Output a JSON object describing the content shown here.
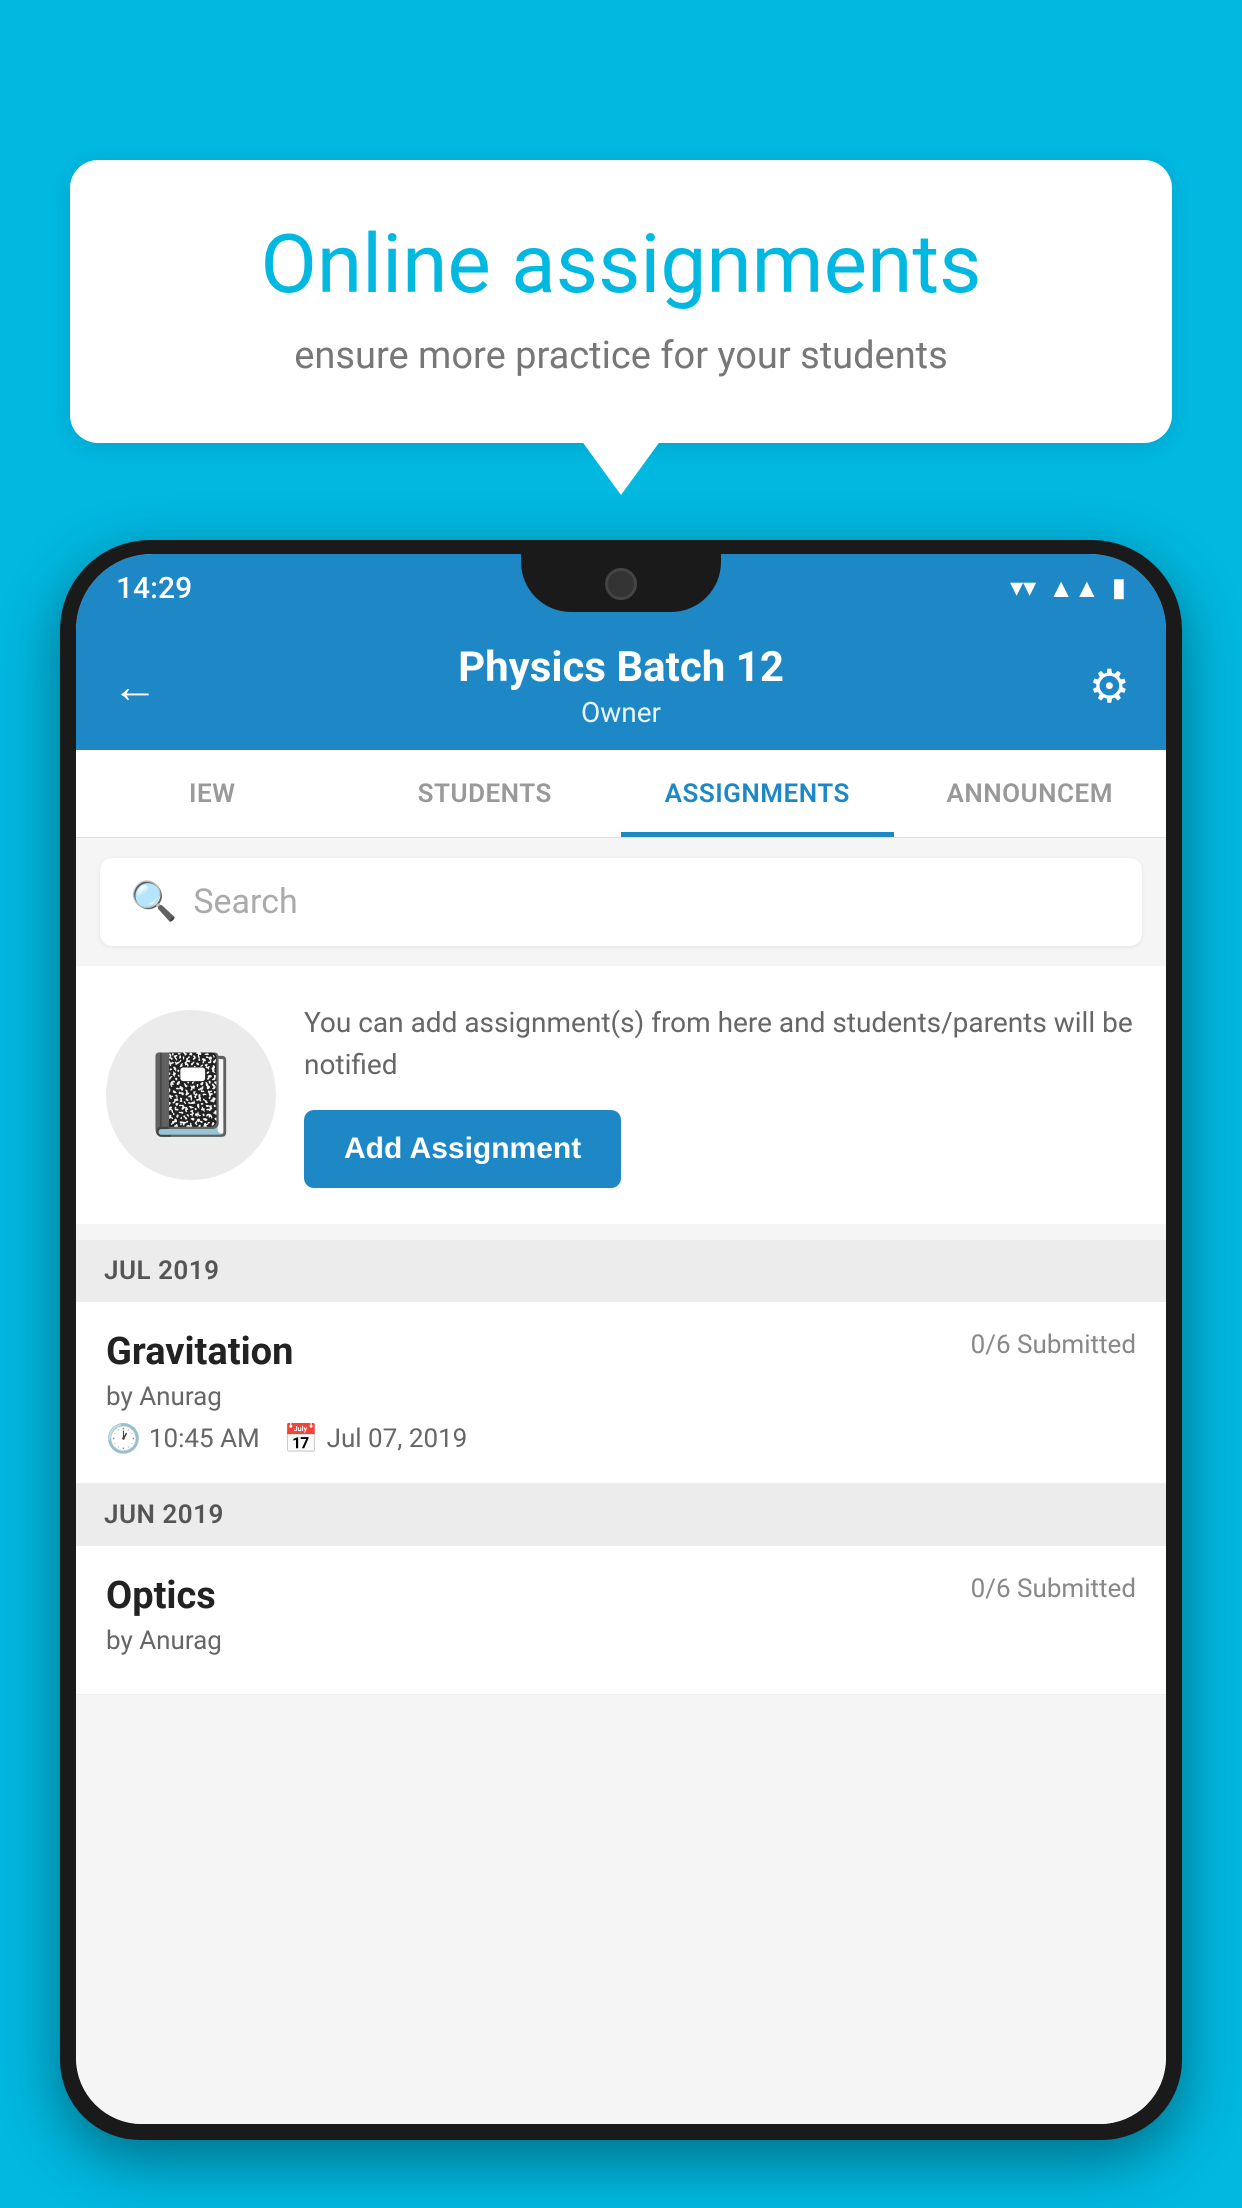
{
  "background_color": "#00b8e0",
  "bubble": {
    "title": "Online assignments",
    "subtitle": "ensure more practice for your students"
  },
  "status_bar": {
    "time": "14:29",
    "icons": [
      "wifi",
      "signal",
      "battery"
    ]
  },
  "header": {
    "title": "Physics Batch 12",
    "subtitle": "Owner",
    "back_label": "←",
    "settings_label": "⚙"
  },
  "tabs": [
    {
      "label": "IEW",
      "active": false
    },
    {
      "label": "STUDENTS",
      "active": false
    },
    {
      "label": "ASSIGNMENTS",
      "active": true
    },
    {
      "label": "ANNOUNCEM",
      "active": false
    }
  ],
  "search": {
    "placeholder": "Search"
  },
  "promo": {
    "description": "You can add assignment(s) from here and students/parents will be notified",
    "button_label": "Add Assignment"
  },
  "sections": [
    {
      "month": "JUL 2019",
      "assignments": [
        {
          "name": "Gravitation",
          "submitted": "0/6 Submitted",
          "by": "by Anurag",
          "time": "10:45 AM",
          "date": "Jul 07, 2019"
        }
      ]
    },
    {
      "month": "JUN 2019",
      "assignments": [
        {
          "name": "Optics",
          "submitted": "0/6 Submitted",
          "by": "by Anurag",
          "time": "",
          "date": ""
        }
      ]
    }
  ]
}
